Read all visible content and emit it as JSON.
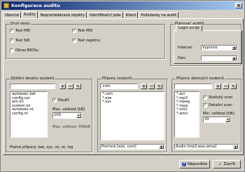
{
  "window": {
    "title": "Konfigurace auditu"
  },
  "tabs": [
    "Obecné",
    "Audity",
    "Neprohledávané objekty",
    "Identifikační pole",
    "Klient",
    "Požadavky na audit"
  ],
  "active_tab": "Audity",
  "druh_testu": {
    "title": "Druh testu",
    "items": [
      {
        "label": "Test HW",
        "checked": true
      },
      {
        "label": "Test MSI",
        "checked": true
      },
      {
        "label": "Test SW",
        "checked": true
      },
      {
        "label": "Test registru",
        "checked": true
      },
      {
        "label": "Obraz BIOSu",
        "checked": false
      }
    ]
  },
  "planovac": {
    "title": "Plánovač auditů",
    "tab": "Login script",
    "interval_label": "Interval:",
    "interval_value": "Vypnuto",
    "den_label": "Den:",
    "den_value": ""
  },
  "zjisteni": {
    "title": "Zjištění obsahu souborů",
    "files": [
      "autoexec.bat",
      "config.sys",
      "win.ini",
      "system.ini",
      "autoexec.nt",
      "config.nt"
    ],
    "pouzit_label": "Použít",
    "pouzit_checked": true,
    "max_label": "Max. velikost [kB]",
    "max_value": "100",
    "max_info": "Max. velikost: 999kB",
    "footer": "Platné přípony: bat, sys, ini, nt, log"
  },
  "pripony": {
    "title": "Přípony souborů",
    "input": ".com",
    "items": [
      "*.com",
      "*.exe",
      "*.sys"
    ],
    "preset": "Povinné [exe, com]"
  },
  "pripony_dat": {
    "title": "Přípony datových souborů",
    "items": [
      "*.avi",
      "*.mp3",
      "*.mpeg",
      "*.mpg",
      "*.mov",
      "*.wmv"
    ],
    "staticky_label": "Statický scan",
    "staticky_checked": true,
    "detailni_label": "Detailní scan",
    "detailni_checked": true,
    "min_label": "Min. velikost [kB]",
    "min_value": "20",
    "preset": "Audio [mp3,wav,wma]"
  },
  "buttons": {
    "help": "Nápověda",
    "close": "Zavřít"
  }
}
